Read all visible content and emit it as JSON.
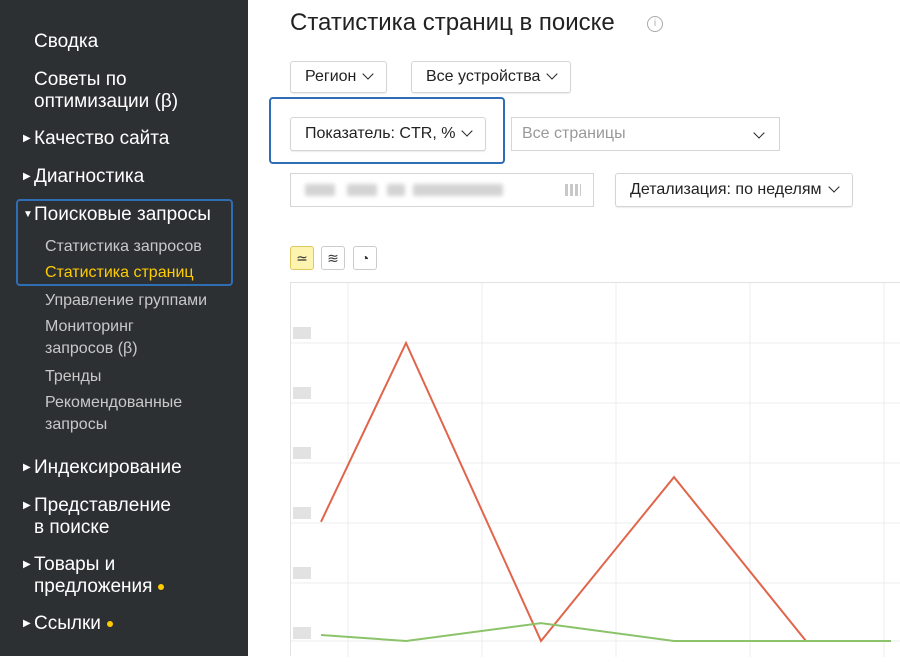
{
  "sidebar": {
    "items": [
      {
        "label": "Сводка"
      },
      {
        "label_line1": "Советы по",
        "label_line2": "оптимизации (β)"
      },
      {
        "label": "Качество сайта"
      },
      {
        "label": "Диагностика"
      },
      {
        "label": "Поисковые запросы"
      },
      {
        "label": "Индексирование"
      },
      {
        "label_line1": "Представление",
        "label_line2": "в поиске"
      },
      {
        "label_line1": "Товары и",
        "label_line2": "предложения"
      },
      {
        "label": "Ссылки"
      }
    ],
    "subitems": [
      {
        "label": "Статистика запросов"
      },
      {
        "label": "Статистика страниц"
      },
      {
        "label": "Управление группами"
      },
      {
        "label_line1": "Мониторинг",
        "label_line2": "запросов (β)"
      },
      {
        "label": "Тренды"
      },
      {
        "label_line1": "Рекомендованные",
        "label_line2": "запросы"
      }
    ]
  },
  "main": {
    "title": "Статистика страниц в поиске",
    "region_label": "Регион",
    "devices_label": "Все устройства",
    "indicator_label": "Показатель: CTR, %",
    "pages_placeholder": "Все страницы",
    "detail_label": "Детализация: по неделям"
  },
  "colors": {
    "sidebar_bg": "#2d3033",
    "active": "#ffcc00",
    "highlight": "#2f6db5",
    "series_red": "#e0654a",
    "series_green": "#8bc36a"
  },
  "chart_data": {
    "type": "line",
    "series": [
      {
        "values": [
          0.4,
          1.0,
          0.0,
          0.55,
          0.0,
          0.0
        ]
      },
      {
        "values": [
          0.02,
          0.0,
          0.06,
          0.0,
          0.0,
          0.0
        ]
      }
    ]
  }
}
